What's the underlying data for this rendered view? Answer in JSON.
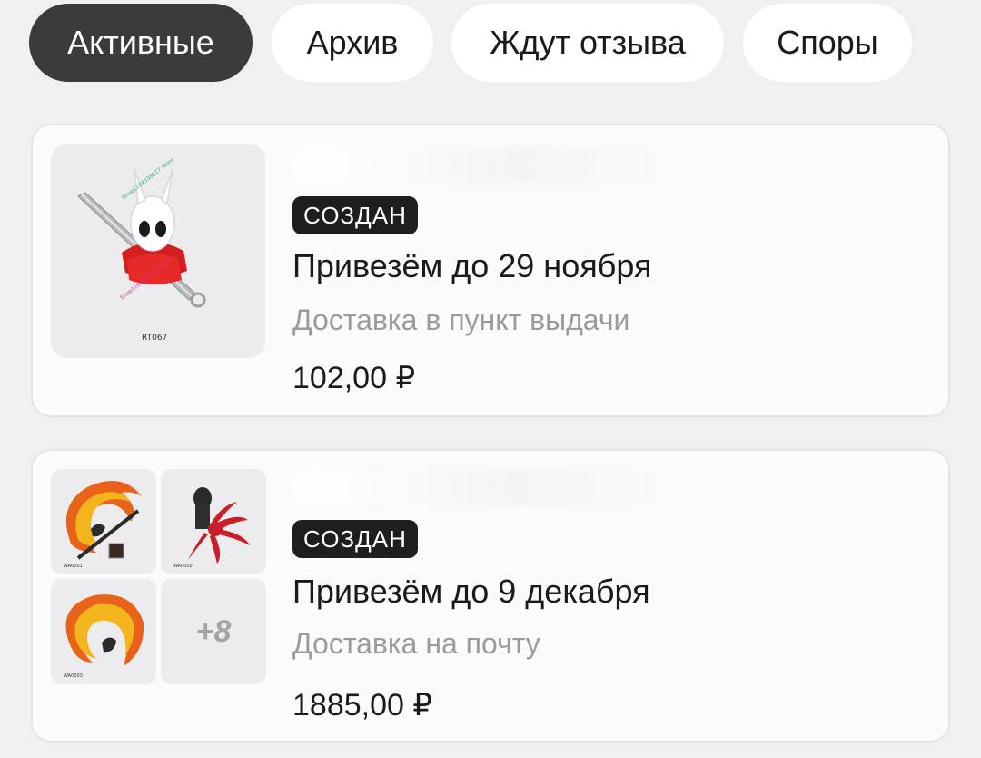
{
  "tabs": [
    {
      "label": "Активные",
      "active": true
    },
    {
      "label": "Архив",
      "active": false
    },
    {
      "label": "Ждут отзыва",
      "active": false
    },
    {
      "label": "Споры",
      "active": false
    }
  ],
  "orders": [
    {
      "status": "СОЗДАН",
      "delivery_date": "Привезём до 29 ноября",
      "delivery_method": "Доставка в пункт выдачи",
      "price": "102,00 ₽",
      "image": {
        "icon": "hornet-figure-icon",
        "caption": "RT067"
      }
    },
    {
      "status": "СОЗДАН",
      "delivery_date": "Привезём до 9 декабря",
      "delivery_method": "Доставка на почту",
      "price": "1885,00 ₽",
      "images": [
        {
          "icon": "flame-sword-figure-icon",
          "caption": "WA0001"
        },
        {
          "icon": "tentacle-figure-icon",
          "caption": "WA0002"
        },
        {
          "icon": "flame-ring-figure-icon",
          "caption": "WA0003"
        }
      ],
      "more_count": "+8"
    }
  ],
  "colors": {
    "background": "#f0f0f2",
    "active_tab": "#3b3b3b",
    "badge": "#1e1e1e",
    "muted_text": "#9a9aa0"
  }
}
